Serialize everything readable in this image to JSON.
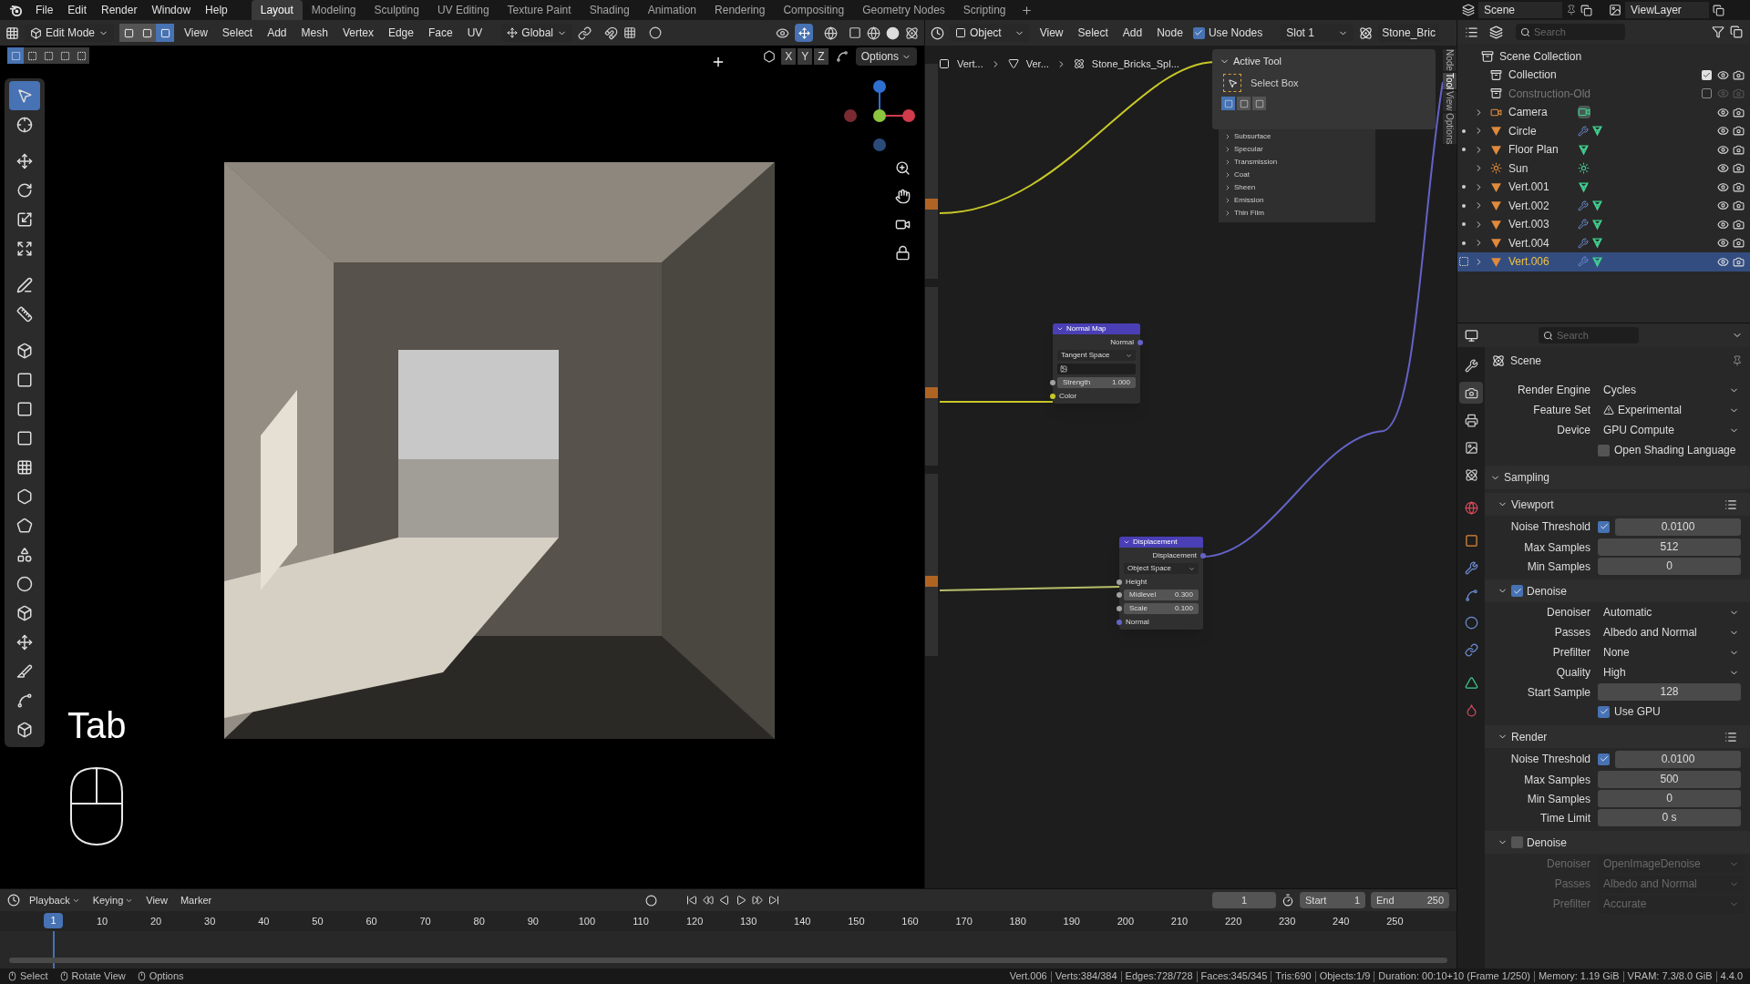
{
  "menu": [
    "File",
    "Edit",
    "Render",
    "Window",
    "Help"
  ],
  "workspaces": [
    {
      "label": "Layout",
      "selected": true
    },
    {
      "label": "Modeling",
      "selected": false
    },
    {
      "label": "Sculpting",
      "selected": false
    },
    {
      "label": "UV Editing",
      "selected": false
    },
    {
      "label": "Texture Paint",
      "selected": false
    },
    {
      "label": "Shading",
      "selected": false
    },
    {
      "label": "Animation",
      "selected": false
    },
    {
      "label": "Rendering",
      "selected": false
    },
    {
      "label": "Compositing",
      "selected": false
    },
    {
      "label": "Geometry Nodes",
      "selected": false
    },
    {
      "label": "Scripting",
      "selected": false
    }
  ],
  "scene": "Scene",
  "view_layer": "ViewLayer",
  "viewport": {
    "mode": "Edit Mode",
    "select_modes": [
      {
        "selected": false
      },
      {
        "selected": false
      },
      {
        "selected": true
      }
    ],
    "menus": [
      "View",
      "Select",
      "Add",
      "Mesh",
      "Vertex",
      "Edge",
      "Face",
      "UV"
    ],
    "orientation": "Global",
    "box_modes": [
      {
        "selected": true
      },
      {
        "selected": false
      },
      {
        "selected": false
      },
      {
        "selected": false
      },
      {
        "selected": false
      }
    ],
    "axes": [
      "X",
      "Y",
      "Z"
    ],
    "options": "Options",
    "key_overlay": "Tab",
    "tools": [
      {
        "selected": true
      },
      {
        "selected": false
      },
      {
        "selected": false
      },
      {
        "selected": false
      },
      {
        "selected": false
      },
      {
        "selected": false
      },
      {
        "selected": false
      },
      {
        "selected": false
      },
      {
        "selected": false
      },
      {
        "selected": false
      },
      {
        "selected": false
      },
      {
        "selected": false
      },
      {
        "selected": false
      },
      {
        "selected": false
      },
      {
        "selected": false
      },
      {
        "selected": false
      },
      {
        "selected": false
      },
      {
        "selected": false
      },
      {
        "selected": false
      },
      {
        "selected": false
      },
      {
        "selected": false
      },
      {
        "selected": false
      }
    ]
  },
  "node_editor": {
    "object_mode": "Object",
    "menus": [
      "View",
      "Select",
      "Add",
      "Node"
    ],
    "use_nodes": {
      "label": "Use Nodes",
      "checked": true
    },
    "slot": "Slot 1",
    "material": "Stone_Bric",
    "breadcrumbs": [
      "Vert...",
      "Ver...",
      "Stone_Bricks_Spl..."
    ],
    "side_tabs": [
      {
        "label": "Node",
        "selected": false
      },
      {
        "label": "Tool",
        "selected": true
      },
      {
        "label": "View",
        "selected": false
      },
      {
        "label": "Options",
        "selected": false
      }
    ],
    "active_tool": {
      "title": "Active Tool",
      "tool": "Select Box",
      "modes": [
        {
          "selected": true
        },
        {
          "selected": false
        },
        {
          "selected": false
        }
      ]
    },
    "panels": [
      {
        "label": "Subsurface",
        "expanded": false
      },
      {
        "label": "Specular",
        "expanded": false
      },
      {
        "label": "Transmission",
        "expanded": false
      },
      {
        "label": "Coat",
        "expanded": false
      },
      {
        "label": "Sheen",
        "expanded": false
      },
      {
        "label": "Emission",
        "expanded": false
      },
      {
        "label": "Thin Film",
        "expanded": false
      }
    ],
    "nodes": [
      {
        "title": "Normal Map",
        "rows": [
          {
            "kind": "output",
            "label": "Normal",
            "color": "#6363c7"
          },
          {
            "kind": "dropdown",
            "value": "Tangent Space"
          },
          {
            "kind": "uv_field"
          },
          {
            "kind": "field",
            "label": "Strength",
            "value": "1.000",
            "color": "#a1a1a1"
          },
          {
            "kind": "input",
            "label": "Color",
            "color": "#c7c729"
          }
        ]
      },
      {
        "title": "Displacement",
        "rows": [
          {
            "kind": "output",
            "label": "Displacement",
            "color": "#6363c7"
          },
          {
            "kind": "dropdown",
            "value": "Object Space"
          },
          {
            "kind": "input",
            "label": "Height",
            "color": "#a1a1a1"
          },
          {
            "kind": "field",
            "label": "Midlevel",
            "value": "0.300",
            "color": "#a1a1a1"
          },
          {
            "kind": "field",
            "label": "Scale",
            "value": "0.100",
            "color": "#a1a1a1"
          },
          {
            "kind": "input",
            "label": "Normal",
            "color": "#6363c7"
          }
        ]
      }
    ]
  },
  "outliner": {
    "search": {
      "placeholder": "Search"
    },
    "root": "Scene Collection",
    "items": [
      {
        "name": "Collection",
        "kind": "collection",
        "checked": true,
        "disabled": false,
        "selected": false
      },
      {
        "name": "Construction-Old",
        "kind": "collection",
        "checked": false,
        "disabled": true,
        "selected": false
      },
      {
        "name": "Camera",
        "kind": "camera",
        "modifier": false,
        "expanded": false,
        "selected": false
      },
      {
        "name": "Circle",
        "kind": "mesh",
        "modifier": true,
        "expanded": false,
        "selected": false
      },
      {
        "name": "Floor Plan",
        "kind": "mesh",
        "modifier": false,
        "expanded": false,
        "selected": false
      },
      {
        "name": "Sun",
        "kind": "light",
        "modifier": false,
        "expanded": false,
        "selected": false
      },
      {
        "name": "Vert.001",
        "kind": "mesh",
        "modifier": false,
        "expanded": false,
        "selected": false
      },
      {
        "name": "Vert.002",
        "kind": "mesh",
        "modifier": true,
        "expanded": false,
        "selected": false
      },
      {
        "name": "Vert.003",
        "kind": "mesh",
        "modifier": true,
        "expanded": false,
        "selected": false
      },
      {
        "name": "Vert.004",
        "kind": "mesh",
        "modifier": true,
        "expanded": false,
        "selected": false
      },
      {
        "name": "Vert.006",
        "kind": "mesh",
        "modifier": true,
        "expanded": false,
        "selected": true
      }
    ]
  },
  "properties": {
    "search": {
      "placeholder": "Search"
    },
    "context": "Scene",
    "tabs": [
      {
        "selected": false
      },
      {
        "selected": true
      },
      {
        "selected": false
      },
      {
        "selected": false
      },
      {
        "selected": false
      },
      {
        "selected": false
      },
      {
        "selected": false
      },
      {
        "selected": false
      },
      {
        "selected": false
      },
      {
        "selected": false
      },
      {
        "selected": false
      },
      {
        "selected": false
      },
      {
        "selected": false
      }
    ],
    "rows": [
      {
        "kind": "dropdown",
        "label": "Render Engine",
        "value": "Cycles",
        "disabled": false
      },
      {
        "kind": "dropdown",
        "label": "Feature Set",
        "value": "Experimental",
        "warning": true,
        "disabled": false
      },
      {
        "kind": "dropdown",
        "label": "Device",
        "value": "GPU Compute",
        "disabled": false
      },
      {
        "kind": "checkbox",
        "label": "Open Shading Language",
        "checked": false,
        "disabled": false
      },
      {
        "kind": "panel",
        "label": "Sampling",
        "expanded": true
      },
      {
        "kind": "subpanel",
        "label": "Viewport",
        "expanded": true
      },
      {
        "kind": "toggle_number",
        "label": "Noise Threshold",
        "checked": true,
        "value": "0.0100",
        "disabled": false
      },
      {
        "kind": "number",
        "label": "Max Samples",
        "value": "512",
        "disabled": false
      },
      {
        "kind": "number",
        "label": "Min Samples",
        "value": "0",
        "disabled": false
      },
      {
        "kind": "subpanel_check",
        "label": "Denoise",
        "checked": true,
        "expanded": true
      },
      {
        "kind": "dropdown",
        "label": "Denoiser",
        "value": "Automatic",
        "disabled": false
      },
      {
        "kind": "dropdown",
        "label": "Passes",
        "value": "Albedo and Normal",
        "disabled": false
      },
      {
        "kind": "dropdown",
        "label": "Prefilter",
        "value": "None",
        "disabled": false
      },
      {
        "kind": "dropdown",
        "label": "Quality",
        "value": "High",
        "disabled": false
      },
      {
        "kind": "number",
        "label": "Start Sample",
        "value": "128",
        "disabled": false
      },
      {
        "kind": "checkbox",
        "label": "Use GPU",
        "checked": true,
        "disabled": false
      },
      {
        "kind": "subpanel",
        "label": "Render",
        "expanded": true
      },
      {
        "kind": "toggle_number",
        "label": "Noise Threshold",
        "checked": true,
        "value": "0.0100",
        "disabled": false
      },
      {
        "kind": "number",
        "label": "Max Samples",
        "value": "500",
        "disabled": false
      },
      {
        "kind": "number",
        "label": "Min Samples",
        "value": "0",
        "disabled": false
      },
      {
        "kind": "number",
        "label": "Time Limit",
        "value": "0 s",
        "disabled": false
      },
      {
        "kind": "subpanel_check",
        "label": "Denoise",
        "checked": false,
        "expanded": true
      },
      {
        "kind": "dropdown",
        "label": "Denoiser",
        "value": "OpenImageDenoise",
        "disabled": true
      },
      {
        "kind": "dropdown",
        "label": "Passes",
        "value": "Albedo and Normal",
        "disabled": true
      },
      {
        "kind": "dropdown",
        "label": "Prefilter",
        "value": "Accurate",
        "disabled": true
      }
    ]
  },
  "timeline": {
    "menus": [
      "Playback",
      "Keying",
      "View",
      "Marker"
    ],
    "current_frame": "1",
    "start_label": "Start",
    "start": "1",
    "end_label": "End",
    "end": "250",
    "ruler_current": "1",
    "ruler": [
      "10",
      "20",
      "30",
      "40",
      "50",
      "60",
      "70",
      "80",
      "90",
      "100",
      "110",
      "120",
      "130",
      "140",
      "150",
      "160",
      "170",
      "180",
      "190",
      "200",
      "210",
      "220",
      "230",
      "240",
      "250"
    ]
  },
  "status_bar": {
    "hints": [
      "Select",
      "Rotate View",
      "Options"
    ],
    "stats": [
      "Vert.006",
      "Verts:384/384",
      "Edges:728/728",
      "Faces:345/345",
      "Tris:690",
      "Objects:1/9",
      "Duration: 00:10+10 (Frame 1/250)",
      "Memory: 1.19 GiB",
      "VRAM: 7.3/8.0 GiB",
      "4.4.0"
    ]
  }
}
